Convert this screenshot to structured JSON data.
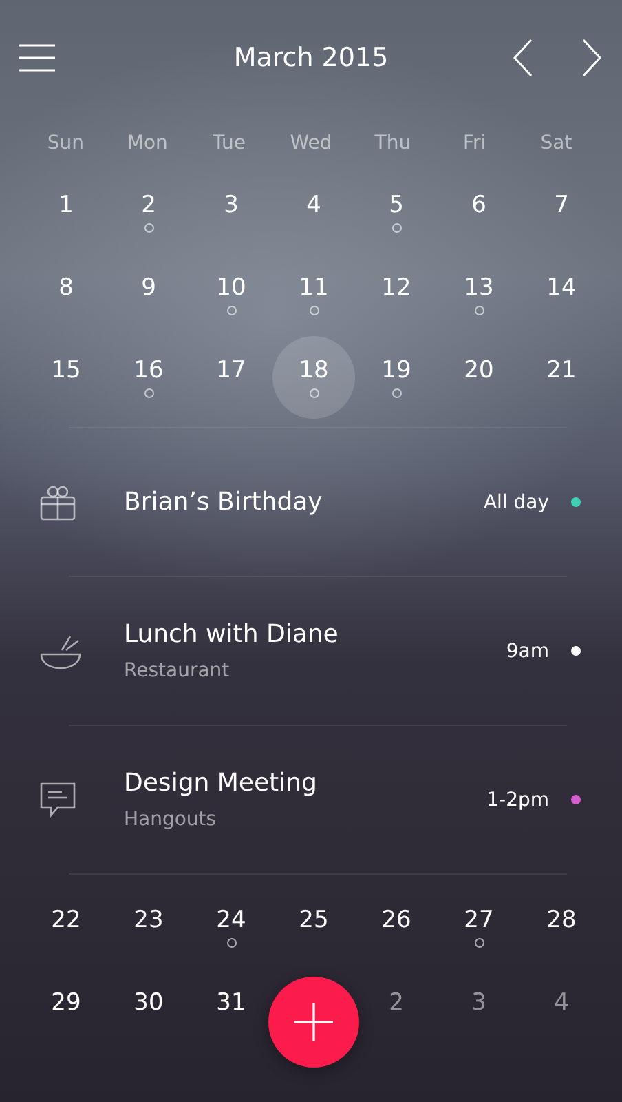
{
  "header": {
    "title": "March 2015"
  },
  "weekdays": [
    "Sun",
    "Mon",
    "Tue",
    "Wed",
    "Thu",
    "Fri",
    "Sat"
  ],
  "top_weeks": [
    [
      {
        "label": "1",
        "event": false,
        "selected": false,
        "muted": false
      },
      {
        "label": "2",
        "event": true,
        "selected": false,
        "muted": false
      },
      {
        "label": "3",
        "event": false,
        "selected": false,
        "muted": false
      },
      {
        "label": "4",
        "event": false,
        "selected": false,
        "muted": false
      },
      {
        "label": "5",
        "event": true,
        "selected": false,
        "muted": false
      },
      {
        "label": "6",
        "event": false,
        "selected": false,
        "muted": false
      },
      {
        "label": "7",
        "event": false,
        "selected": false,
        "muted": false
      }
    ],
    [
      {
        "label": "8",
        "event": false,
        "selected": false,
        "muted": false
      },
      {
        "label": "9",
        "event": false,
        "selected": false,
        "muted": false
      },
      {
        "label": "10",
        "event": true,
        "selected": false,
        "muted": false
      },
      {
        "label": "11",
        "event": true,
        "selected": false,
        "muted": false
      },
      {
        "label": "12",
        "event": false,
        "selected": false,
        "muted": false
      },
      {
        "label": "13",
        "event": true,
        "selected": false,
        "muted": false
      },
      {
        "label": "14",
        "event": false,
        "selected": false,
        "muted": false
      }
    ],
    [
      {
        "label": "15",
        "event": false,
        "selected": false,
        "muted": false
      },
      {
        "label": "16",
        "event": true,
        "selected": false,
        "muted": false
      },
      {
        "label": "17",
        "event": false,
        "selected": false,
        "muted": false
      },
      {
        "label": "18",
        "event": true,
        "selected": true,
        "muted": false
      },
      {
        "label": "19",
        "event": true,
        "selected": false,
        "muted": false
      },
      {
        "label": "20",
        "event": false,
        "selected": false,
        "muted": false
      },
      {
        "label": "21",
        "event": false,
        "selected": false,
        "muted": false
      }
    ]
  ],
  "events": [
    {
      "kind": "gift",
      "title": "Brian’s Birthday",
      "time": "All day",
      "color": "#3fd0b4"
    },
    {
      "kind": "bowl",
      "title": "Lunch with Diane",
      "subtitle": "Restaurant",
      "time": "9am",
      "color": "#ffffff"
    },
    {
      "kind": "chat",
      "title": "Design Meeting",
      "subtitle": "Hangouts",
      "time": "1-2pm",
      "color": "#d65ed0"
    }
  ],
  "bottom_weeks": [
    [
      {
        "kind": "day",
        "label": "22",
        "event": false,
        "selected": false,
        "muted": false
      },
      {
        "kind": "day",
        "label": "23",
        "event": false,
        "selected": false,
        "muted": false
      },
      {
        "kind": "day",
        "label": "24",
        "event": true,
        "selected": false,
        "muted": false
      },
      {
        "kind": "day",
        "label": "25",
        "event": false,
        "selected": false,
        "muted": false
      },
      {
        "kind": "day",
        "label": "26",
        "event": false,
        "selected": false,
        "muted": false
      },
      {
        "kind": "day",
        "label": "27",
        "event": true,
        "selected": false,
        "muted": false
      },
      {
        "kind": "day",
        "label": "28",
        "event": false,
        "selected": false,
        "muted": false
      }
    ],
    [
      {
        "kind": "day",
        "label": "29",
        "event": false,
        "selected": false,
        "muted": false
      },
      {
        "kind": "day",
        "label": "30",
        "event": false,
        "selected": false,
        "muted": false
      },
      {
        "kind": "day",
        "label": "31",
        "event": false,
        "selected": false,
        "muted": false
      },
      {
        "kind": "add"
      },
      {
        "kind": "day",
        "label": "2",
        "event": false,
        "selected": false,
        "muted": true
      },
      {
        "kind": "day",
        "label": "3",
        "event": false,
        "selected": false,
        "muted": true
      },
      {
        "kind": "day",
        "label": "4",
        "event": false,
        "selected": false,
        "muted": true
      }
    ]
  ]
}
